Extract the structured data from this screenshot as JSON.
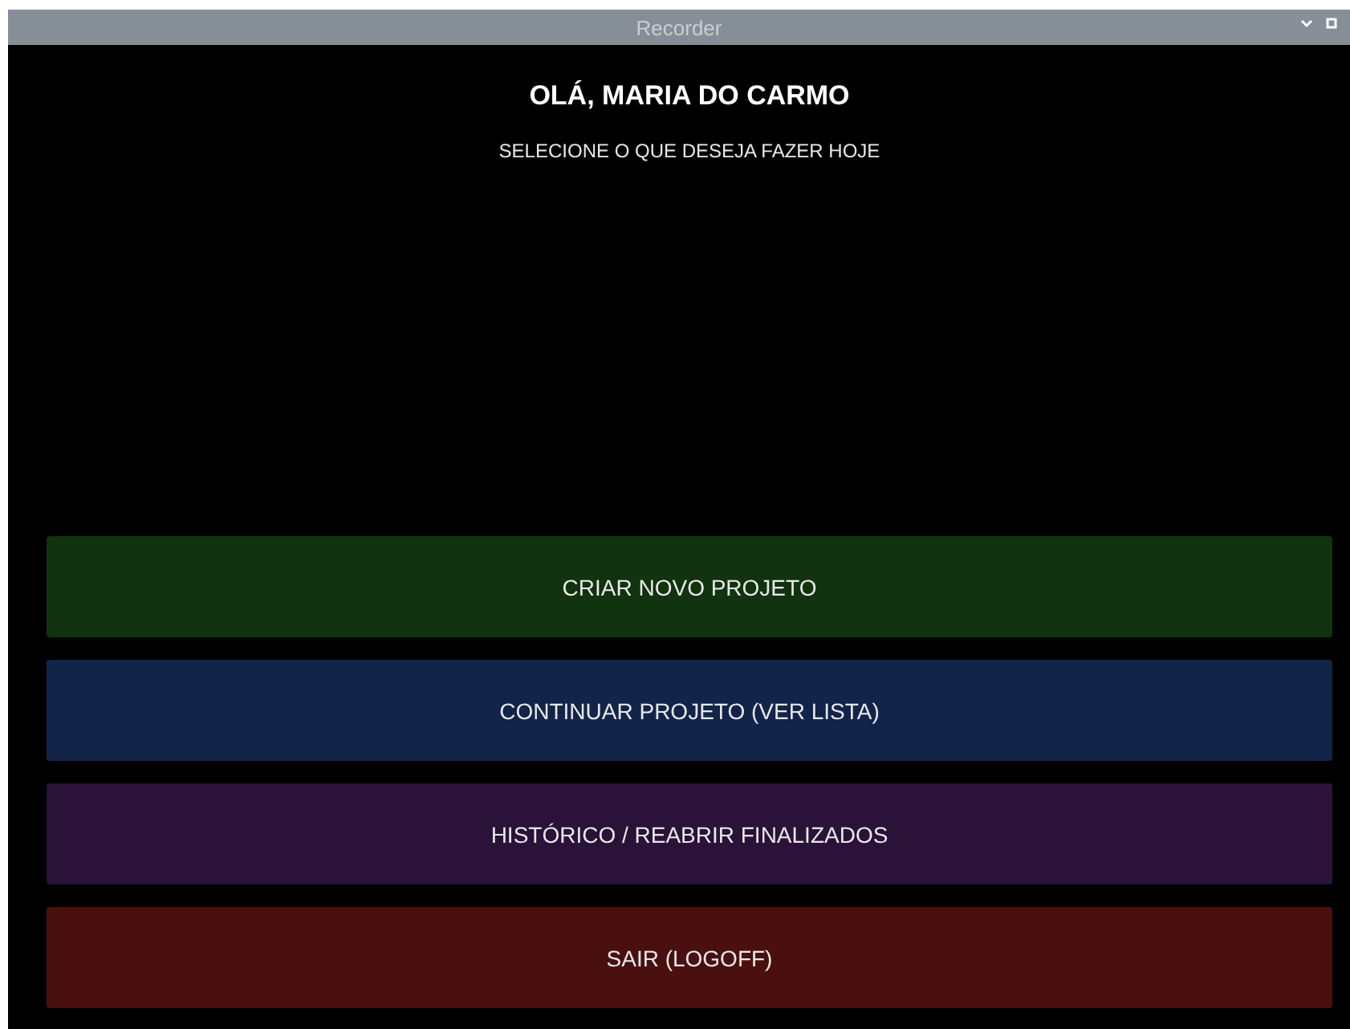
{
  "window": {
    "title": "Recorder"
  },
  "greeting": "OLÁ, MARIA DO CARMO",
  "subtitle": "SELECIONE O QUE DESEJA FAZER HOJE",
  "actions": [
    {
      "label": "CRIAR NOVO PROJETO",
      "color": "#11330f"
    },
    {
      "label": "CONTINUAR PROJETO (VER LISTA)",
      "color": "#12244a"
    },
    {
      "label": "HISTÓRICO / REABRIR FINALIZADOS",
      "color": "#2a1238"
    },
    {
      "label": "SAIR (LOGOFF)",
      "color": "#4a1010"
    }
  ]
}
